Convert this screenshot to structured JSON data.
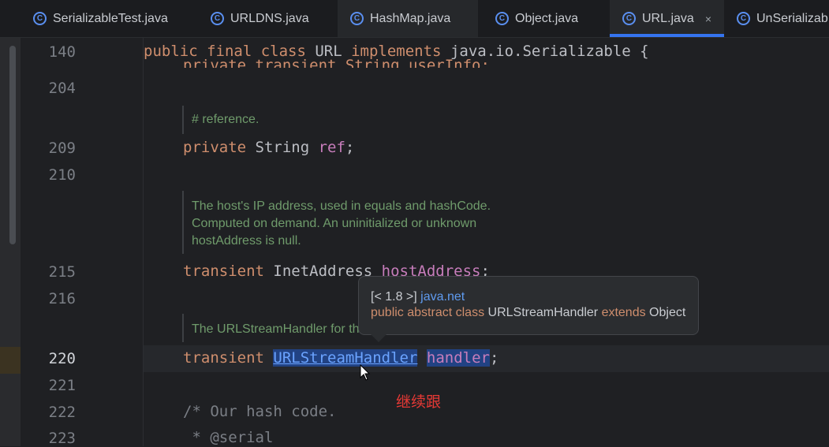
{
  "tabs": [
    {
      "label": "SerializableTest.java",
      "icon": "class-icon"
    },
    {
      "label": "URLDNS.java",
      "icon": "class-icon"
    },
    {
      "label": "HashMap.java",
      "icon": "class-icon"
    },
    {
      "label": "Object.java",
      "icon": "class-icon"
    },
    {
      "label": "URL.java",
      "icon": "class-icon",
      "active": true,
      "close": "×"
    },
    {
      "label": "UnSerializab",
      "icon": "class-icon"
    }
  ],
  "editor": {
    "sticky_line_number": "140",
    "sticky": {
      "kw1": "public final class",
      "name": " URL ",
      "kw2": "implements",
      "rest": " java.io.Serializable {"
    },
    "partial_line": "private transient String userInfo;",
    "line_numbers": {
      "l204": "204",
      "l209": "209",
      "l210": "210",
      "l215": "215",
      "l216": "216",
      "l220": "220",
      "l221": "221",
      "l222": "222",
      "l223": "223"
    },
    "doc_reference": "# reference.",
    "line209": {
      "kw": "private",
      "type": " String ",
      "field": "ref",
      "end": ";"
    },
    "doc_host": [
      "The host's IP address, used in equals and hashCode.",
      "Computed on demand. An uninitialized or unknown",
      "hostAddress is null."
    ],
    "line215": {
      "kw": "transient",
      "type": " InetAddress ",
      "field": "hostAddress",
      "end": ";"
    },
    "doc_handler": "The URLStreamHandler for this URL.",
    "line220": {
      "kw": "transient",
      "type": "URLStreamHandler",
      "field": "handler",
      "end": ";"
    },
    "line222": "/* Our hash code.",
    "line223": " * @serial"
  },
  "tooltip": {
    "version": "[< 1.8 >] ",
    "package": "java.net",
    "kw1": "public abstract class",
    "cls": " URLStreamHandler ",
    "kw2": "extends",
    "parent": " Object"
  },
  "annotation": "继续跟",
  "colors": {
    "keyword": "#cf8e6d",
    "field": "#c77dbb",
    "doc": "#6f9b6b",
    "accent": "#3574f0",
    "annotation": "#e53935"
  }
}
